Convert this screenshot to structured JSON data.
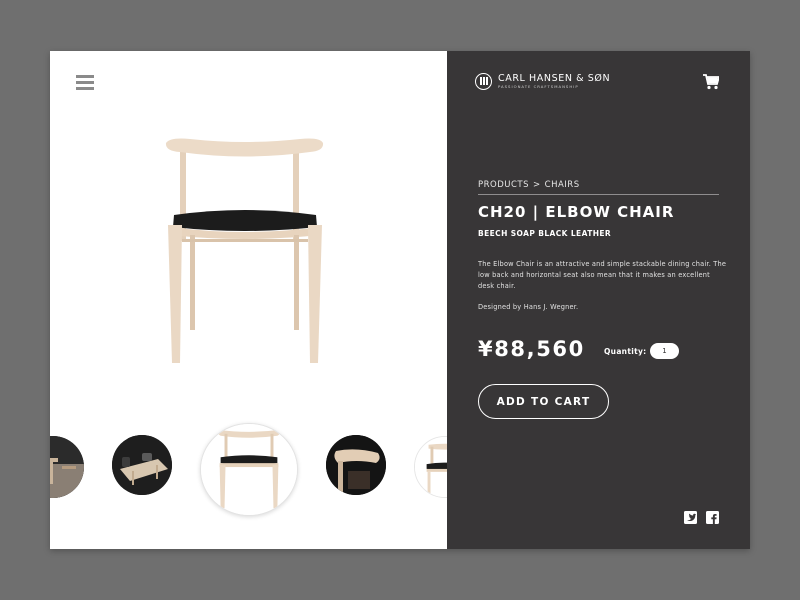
{
  "header": {
    "brand_name": "CARL HANSEN & SØN",
    "tagline": "PASSIONATE CRAFTSMANSHIP"
  },
  "breadcrumb": {
    "items": [
      "PRODUCTS",
      "CHAIRS"
    ],
    "separator": ">"
  },
  "product": {
    "title": "CH20 | ELBOW CHAIR",
    "variant": "BEECH SOAP BLACK LEATHER",
    "description": "The Elbow Chair is an attractive and simple stackable dining chair. The low back and horizontal seat also mean that it makes an excellent desk chair.",
    "designer": "Designed by Hans J. Wegner.",
    "price": "¥88,560",
    "quantity_label": "Quantity:",
    "quantity_value": "1",
    "add_to_cart_label": "ADD TO CART"
  },
  "icons": {
    "menu": "hamburger-menu-icon",
    "cart": "shopping-cart-icon",
    "twitter": "twitter-icon",
    "facebook": "facebook-icon",
    "logo": "logo-mark-icon"
  },
  "gallery": {
    "selected_index": 2
  },
  "colors": {
    "panel_dark": "#383637",
    "page_bg": "#6f6f6f",
    "wood": "#ead8c4",
    "leather": "#1c1c1c"
  }
}
